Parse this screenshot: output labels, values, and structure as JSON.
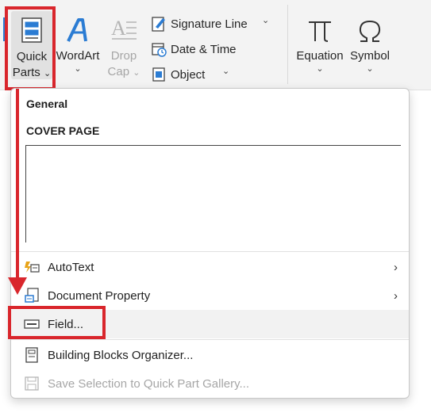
{
  "ribbon": {
    "quick_parts_line1": "Quick",
    "quick_parts_line2": "Parts",
    "wordart": "WordArt",
    "dropcap_line1": "Drop",
    "dropcap_line2": "Cap",
    "signature_line": "Signature Line",
    "date_time": "Date & Time",
    "object": "Object",
    "equation": "Equation",
    "symbol": "Symbol",
    "chevron": "⌄"
  },
  "menu": {
    "general_heading": "General",
    "cover_page_heading": "COVER PAGE",
    "items": [
      {
        "label": "AutoText",
        "icon": "autotext-icon",
        "has_submenu": true
      },
      {
        "label": "Document Property",
        "icon": "document-property-icon",
        "has_submenu": true
      },
      {
        "label": "Field...",
        "icon": "field-icon",
        "has_submenu": false,
        "highlighted": true
      },
      {
        "label": "Building Blocks Organizer...",
        "icon": "building-blocks-icon",
        "has_submenu": false
      },
      {
        "label": "Save Selection to Quick Part Gallery...",
        "icon": "save-icon",
        "has_submenu": false,
        "disabled": true
      }
    ],
    "submenu_arrow": "›"
  },
  "colors": {
    "highlight_red": "#d9262c",
    "accent_blue": "#2b7cd3",
    "disabled_gray": "#a6a6a6"
  }
}
